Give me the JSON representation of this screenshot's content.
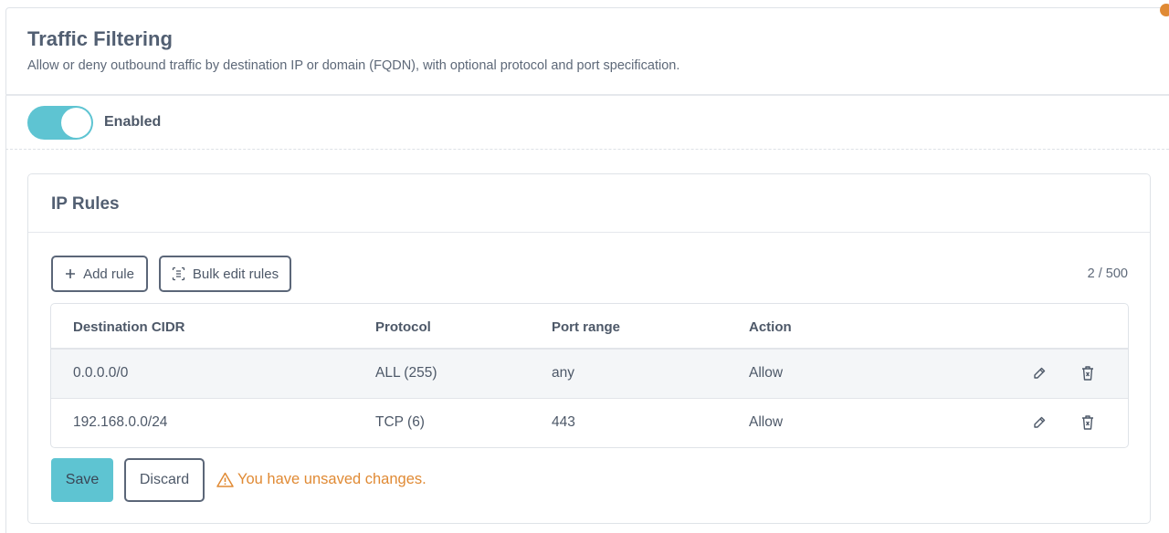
{
  "header": {
    "title": "Traffic Filtering",
    "subtitle": "Allow or deny outbound traffic by destination IP or domain (FQDN), with optional protocol and port specification."
  },
  "toggle": {
    "label": "Enabled",
    "state": "on"
  },
  "ip_rules": {
    "title": "IP Rules",
    "add_rule_label": "Add rule",
    "bulk_edit_label": "Bulk edit rules",
    "count": "2 / 500",
    "columns": [
      "Destination CIDR",
      "Protocol",
      "Port range",
      "Action"
    ],
    "rows": [
      {
        "cidr": "0.0.0.0/0",
        "protocol": "ALL (255)",
        "port": "any",
        "action": "Allow"
      },
      {
        "cidr": "192.168.0.0/24",
        "protocol": "TCP (6)",
        "port": "443",
        "action": "Allow"
      }
    ]
  },
  "footer": {
    "save_label": "Save",
    "discard_label": "Discard",
    "warning": "You have unsaved changes."
  },
  "colors": {
    "accent": "#5ec4d2",
    "warning": "#e08a34",
    "text": "#4d5868"
  }
}
